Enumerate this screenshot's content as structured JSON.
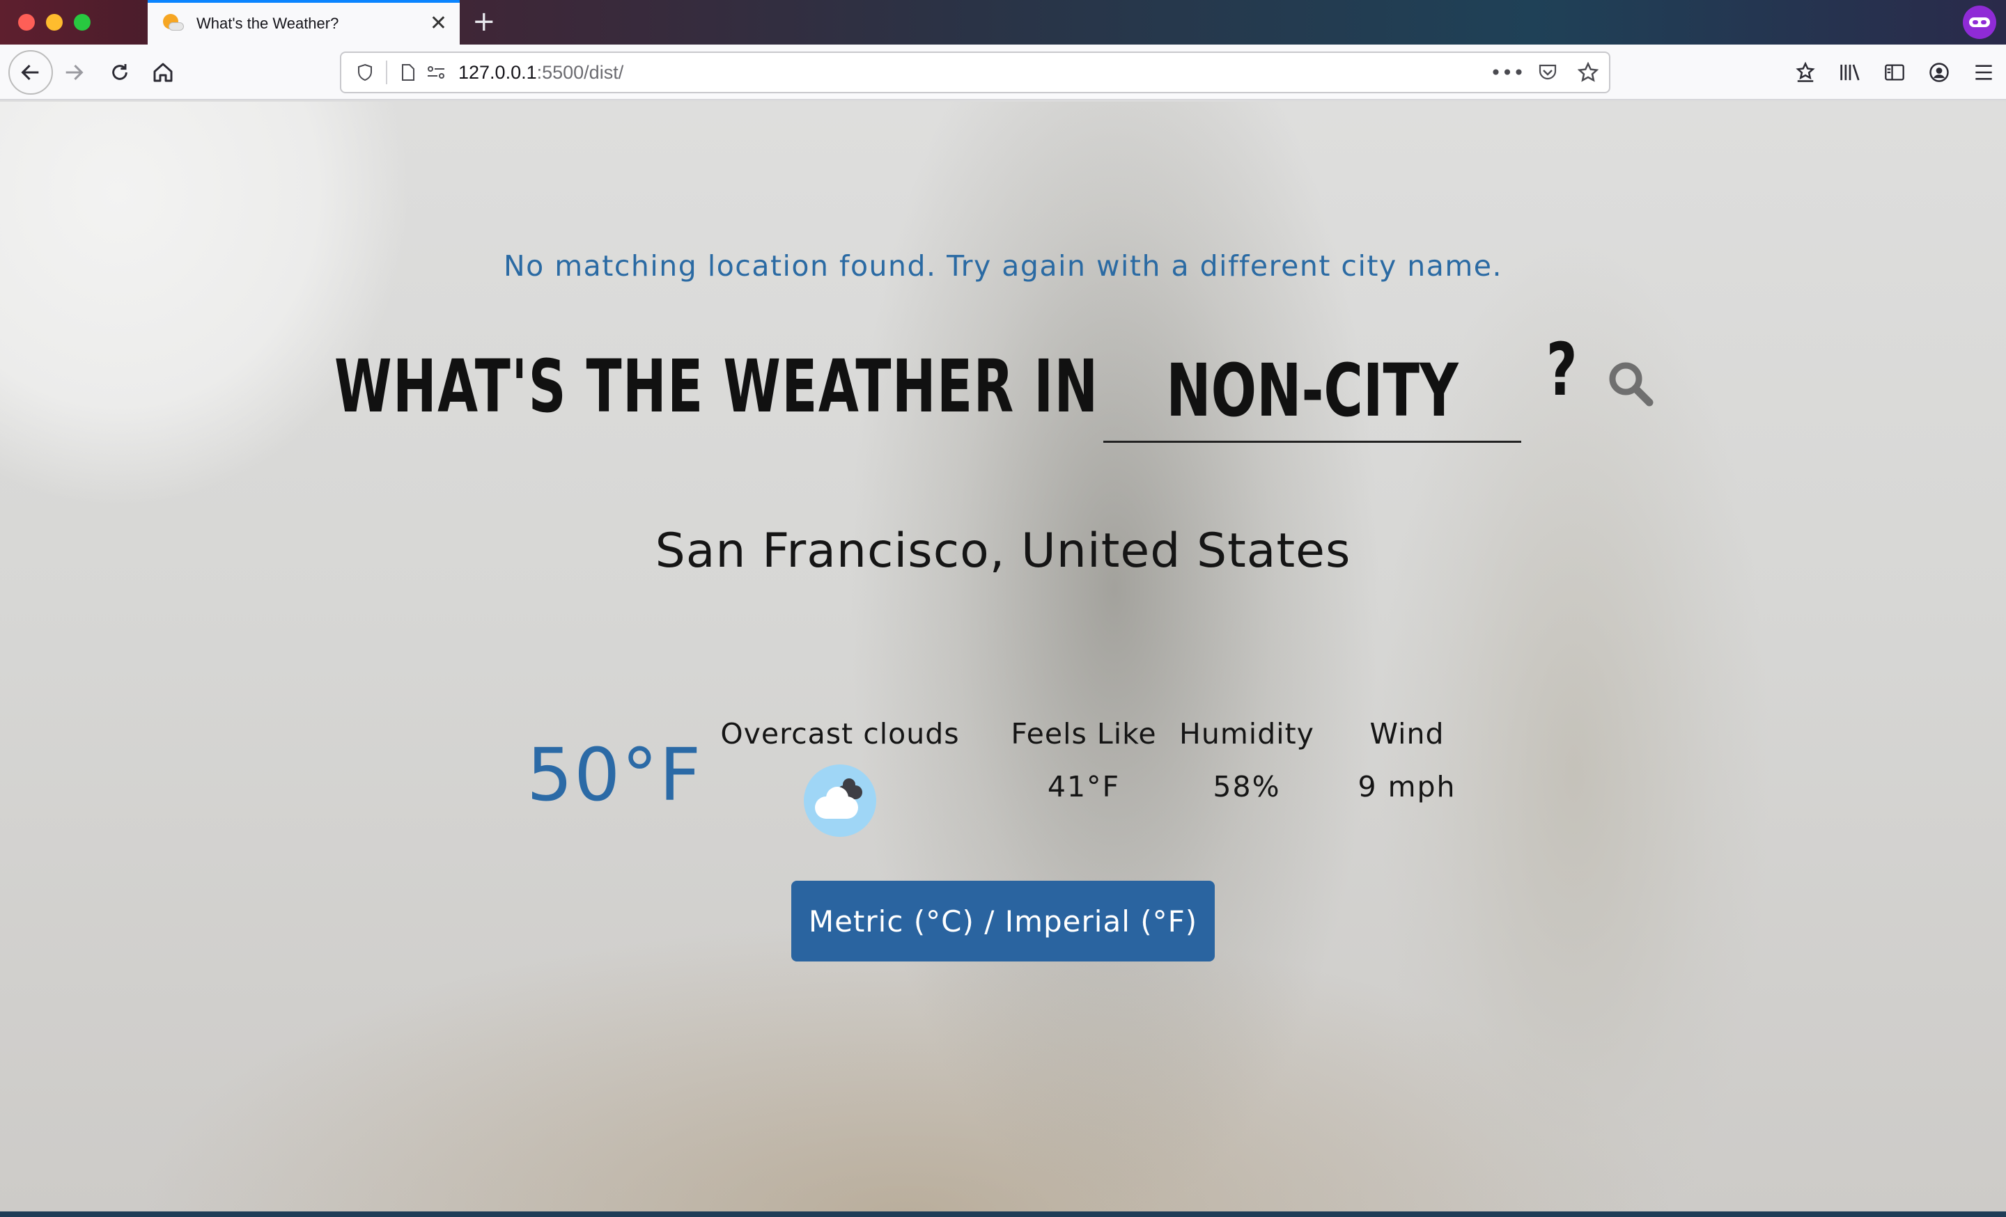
{
  "browser": {
    "tab_title": "What's the Weather?",
    "url_host": "127.0.0.1",
    "url_rest": ":5500/dist/",
    "icons": [
      "back-icon",
      "forward-icon",
      "reload-icon",
      "home-icon",
      "shield-icon",
      "page-icon",
      "permissions-icon",
      "more-icon",
      "pocket-icon",
      "bookmark-star-icon",
      "bookmarks-toolbar-icon",
      "library-icon",
      "sidebar-icon",
      "account-icon",
      "menu-icon",
      "private-browsing-icon"
    ]
  },
  "page": {
    "error_message": "No matching location found. Try again with a different city name.",
    "headline": "WHAT'S THE WEATHER IN",
    "city_value": "NON-CITY",
    "question_mark": "?",
    "location": "San Francisco, United States",
    "temperature": "50°F",
    "description": "Overcast clouds",
    "feels_like_label": "Feels Like",
    "feels_like_value": "41°F",
    "humidity_label": "Humidity",
    "humidity_value": "58%",
    "wind_label": "Wind",
    "wind_value": "9 mph",
    "toggle_label": "Metric (°C) / Imperial (°F)"
  },
  "colors": {
    "accent_blue": "#2a64a0",
    "temperature_blue": "#2b6aa6",
    "tab_accent": "#0a84ff",
    "weather_icon_bg": "#9fd6f6"
  }
}
